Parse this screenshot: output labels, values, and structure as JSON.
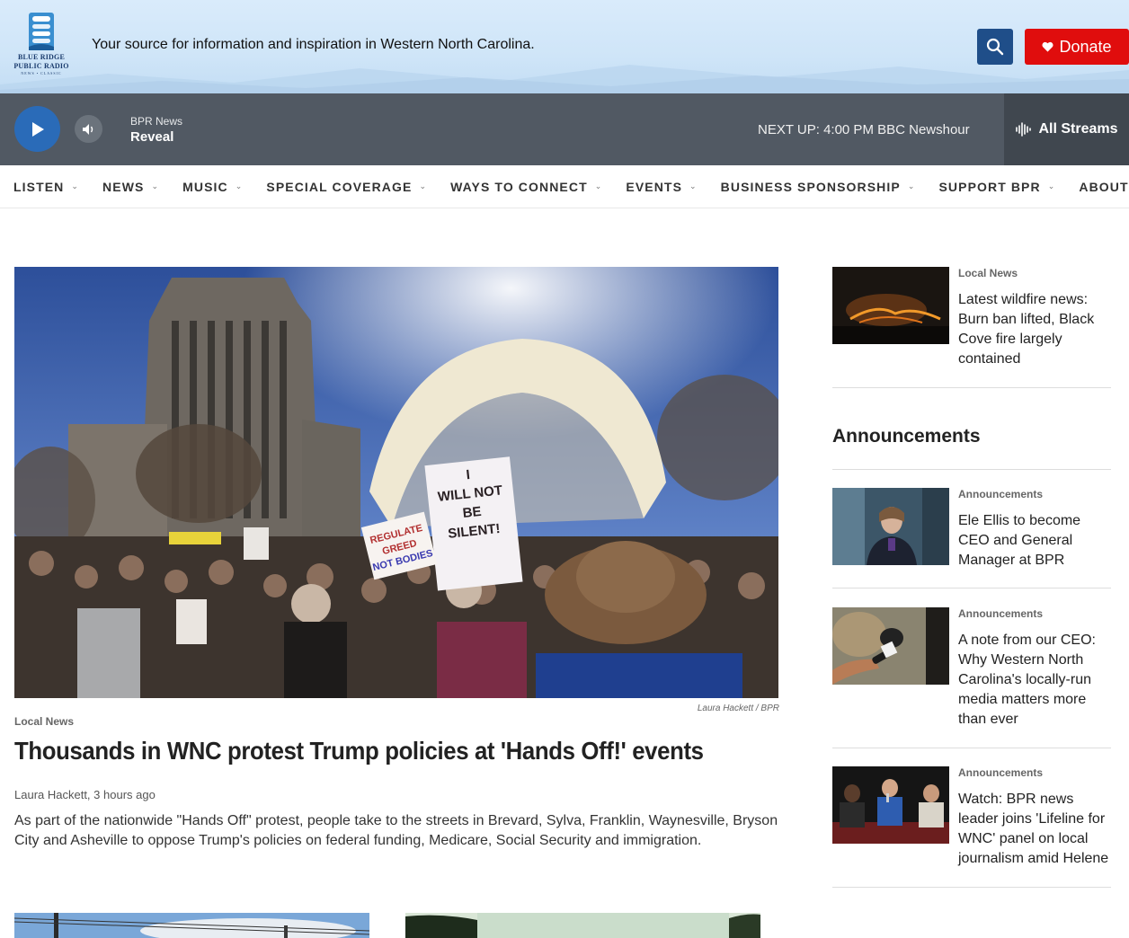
{
  "header": {
    "logo": {
      "line1": "BLUE RIDGE",
      "line2": "PUBLIC RADIO",
      "line3": "NEWS • CLASSIC"
    },
    "tagline": "Your source for information and inspiration in Western North Carolina.",
    "search_icon": "search-icon",
    "donate_label": "Donate",
    "colors": {
      "donate": "#e00d0d",
      "search": "#1f4e89"
    }
  },
  "player": {
    "station": "BPR News",
    "program": "Reveal",
    "next_up": "NEXT UP: 4:00 PM BBC Newshour",
    "all_streams": "All Streams",
    "colors": {
      "bar": "#515963",
      "play": "#2a6bb8"
    }
  },
  "nav": {
    "items": [
      {
        "label": "LISTEN"
      },
      {
        "label": "NEWS"
      },
      {
        "label": "MUSIC"
      },
      {
        "label": "SPECIAL COVERAGE"
      },
      {
        "label": "WAYS TO CONNECT"
      },
      {
        "label": "EVENTS"
      },
      {
        "label": "BUSINESS SPONSORSHIP"
      },
      {
        "label": "SUPPORT BPR"
      },
      {
        "label": "ABOUT US"
      }
    ]
  },
  "main_story": {
    "photo_credit": "Laura Hackett  /  BPR",
    "kicker": "Local News",
    "headline": "Thousands in WNC protest Trump policies at 'Hands Off!' events",
    "byline": "Laura Hackett, 3 hours ago",
    "teaser": "As part of the nationwide \"Hands Off\" protest, people take to the streets in Brevard, Sylva, Franklin, Waynesville, Bryson City and Asheville to oppose Trump's policies on federal funding, Medicare, Social Security and immigration.",
    "sign_text": "I WILL NOT BE SILENT!",
    "sign_text2": "REGULATE GREED NOT BODIES"
  },
  "sidebar": {
    "top_story": {
      "kicker": "Local News",
      "title": "Latest wildfire news: Burn ban lifted, Black Cove fire largely contained"
    },
    "announcements_heading": "Announcements",
    "announcements": [
      {
        "kicker": "Announcements",
        "title": "Ele Ellis to become CEO and General Manager at BPR"
      },
      {
        "kicker": "Announcements",
        "title": "A note from our CEO: Why Western North Carolina's locally-run media matters more than ever"
      },
      {
        "kicker": "Announcements",
        "title": "Watch: BPR news leader joins 'Lifeline for WNC' panel on local journalism amid Helene"
      }
    ]
  }
}
